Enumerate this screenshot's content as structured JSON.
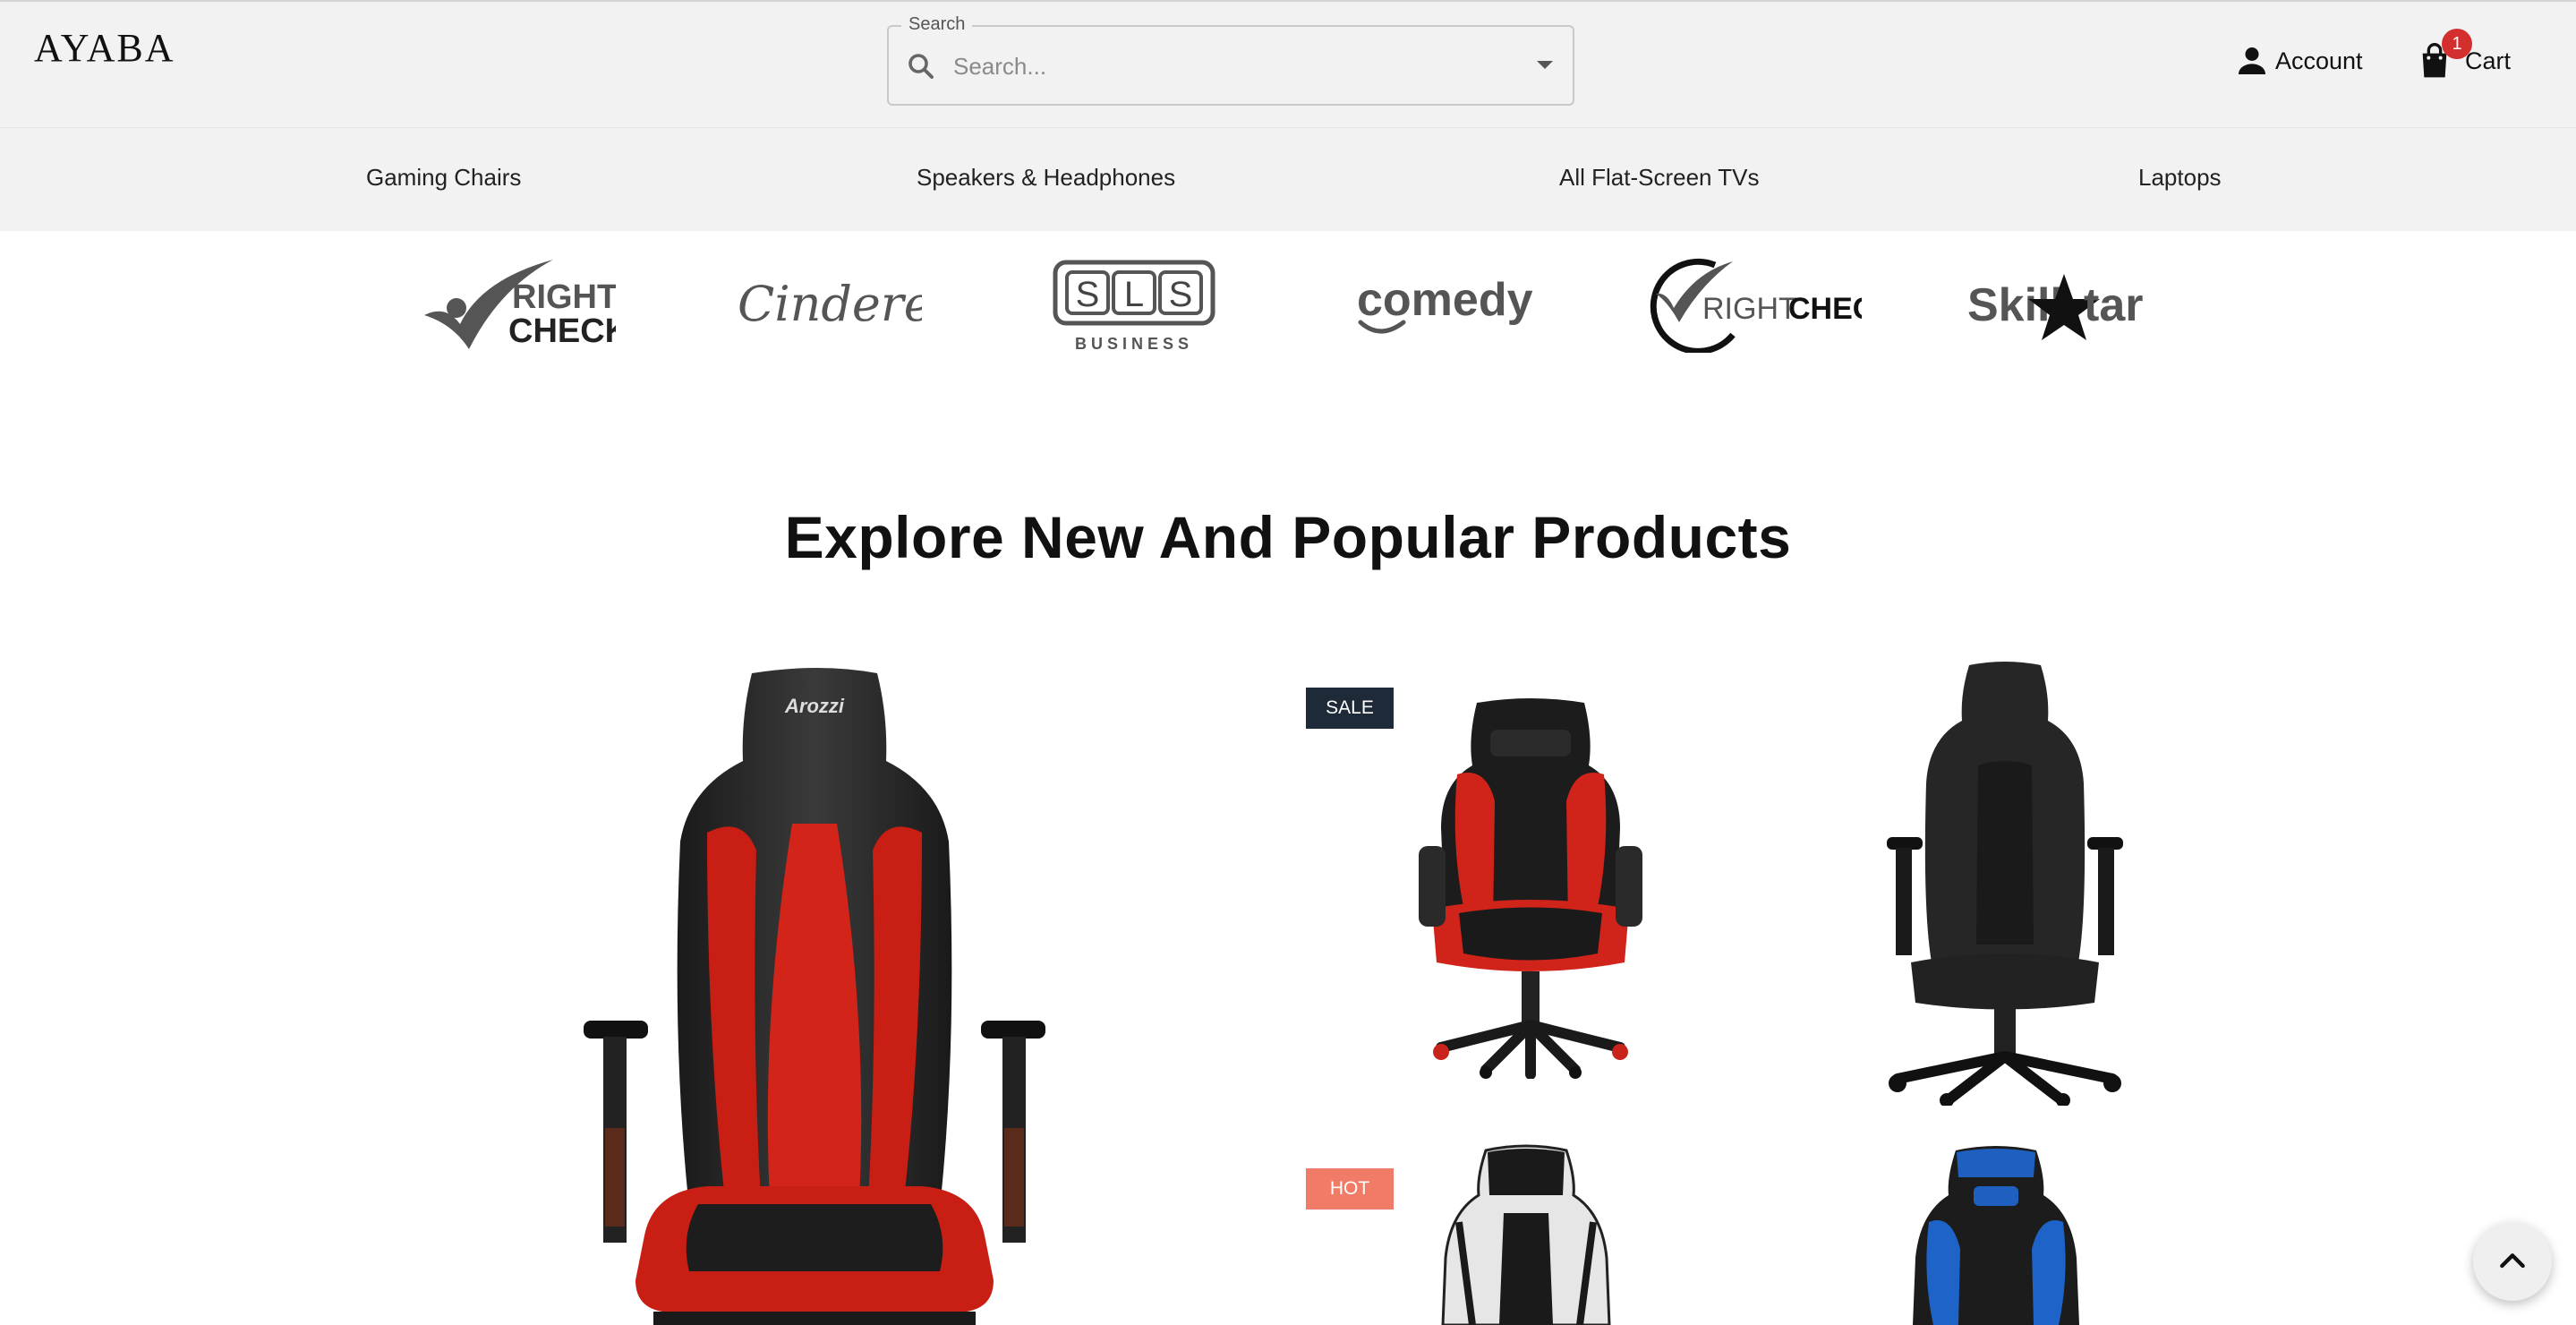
{
  "header": {
    "logo_text": "AYABA",
    "search": {
      "legend": "Search",
      "placeholder": "Search..."
    },
    "account_label": "Account",
    "cart_label": "Cart",
    "cart_count": "1"
  },
  "nav": {
    "items": [
      {
        "label": "Gaming Chairs"
      },
      {
        "label": "Speakers & Headphones"
      },
      {
        "label": "All Flat-Screen TVs"
      },
      {
        "label": "Laptops"
      }
    ]
  },
  "brands": [
    {
      "name": "RIGHT CHECK"
    },
    {
      "name": "Cinderella"
    },
    {
      "name": "SLS BUSINESS"
    },
    {
      "name": "comedy"
    },
    {
      "name": "RIGHTCHECK"
    },
    {
      "name": "SkillStar"
    }
  ],
  "main": {
    "section_title": "Explore New And Popular Products",
    "badges": {
      "sale": "SALE",
      "hot": "HOT"
    },
    "colors": {
      "sale_badge": "#1f2a38",
      "hot_badge": "#f07b67",
      "cart_badge": "#d32f2f"
    }
  }
}
